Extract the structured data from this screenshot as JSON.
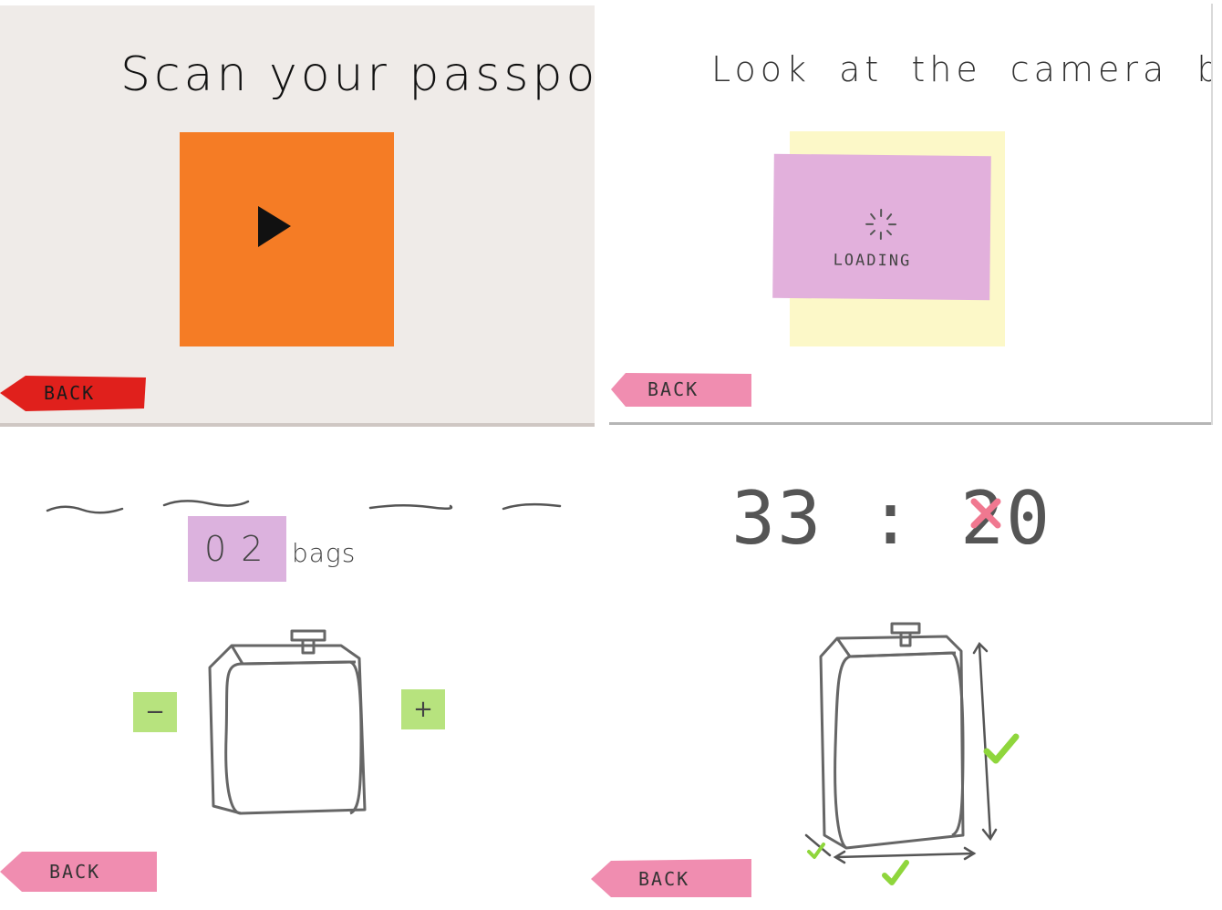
{
  "screens": {
    "scan_passport": {
      "title": "Scan your passport",
      "back_label": "BACK",
      "colors": {
        "paper": "#efebe8",
        "play_tile": "#f57c25",
        "back": "#e0201c"
      }
    },
    "camera": {
      "title": "Look at the camera below",
      "loading_label": "LOADING",
      "back_label": "BACK",
      "colors": {
        "back_tile": "#fcf8c8",
        "front_tile": "#e2b0dc",
        "back": "#f08db0"
      }
    },
    "bags": {
      "count": "0 2",
      "unit": "bags",
      "minus_label": "−",
      "plus_label": "+",
      "back_label": "BACK",
      "colors": {
        "counter": "#dcb2de",
        "stepper": "#b7e37e",
        "back": "#f08db0"
      }
    },
    "timer": {
      "time": "33 : 20",
      "back_label": "BACK",
      "colors": {
        "close": "#f07890",
        "check": "#8fd63c",
        "back": "#f08db0"
      }
    }
  }
}
